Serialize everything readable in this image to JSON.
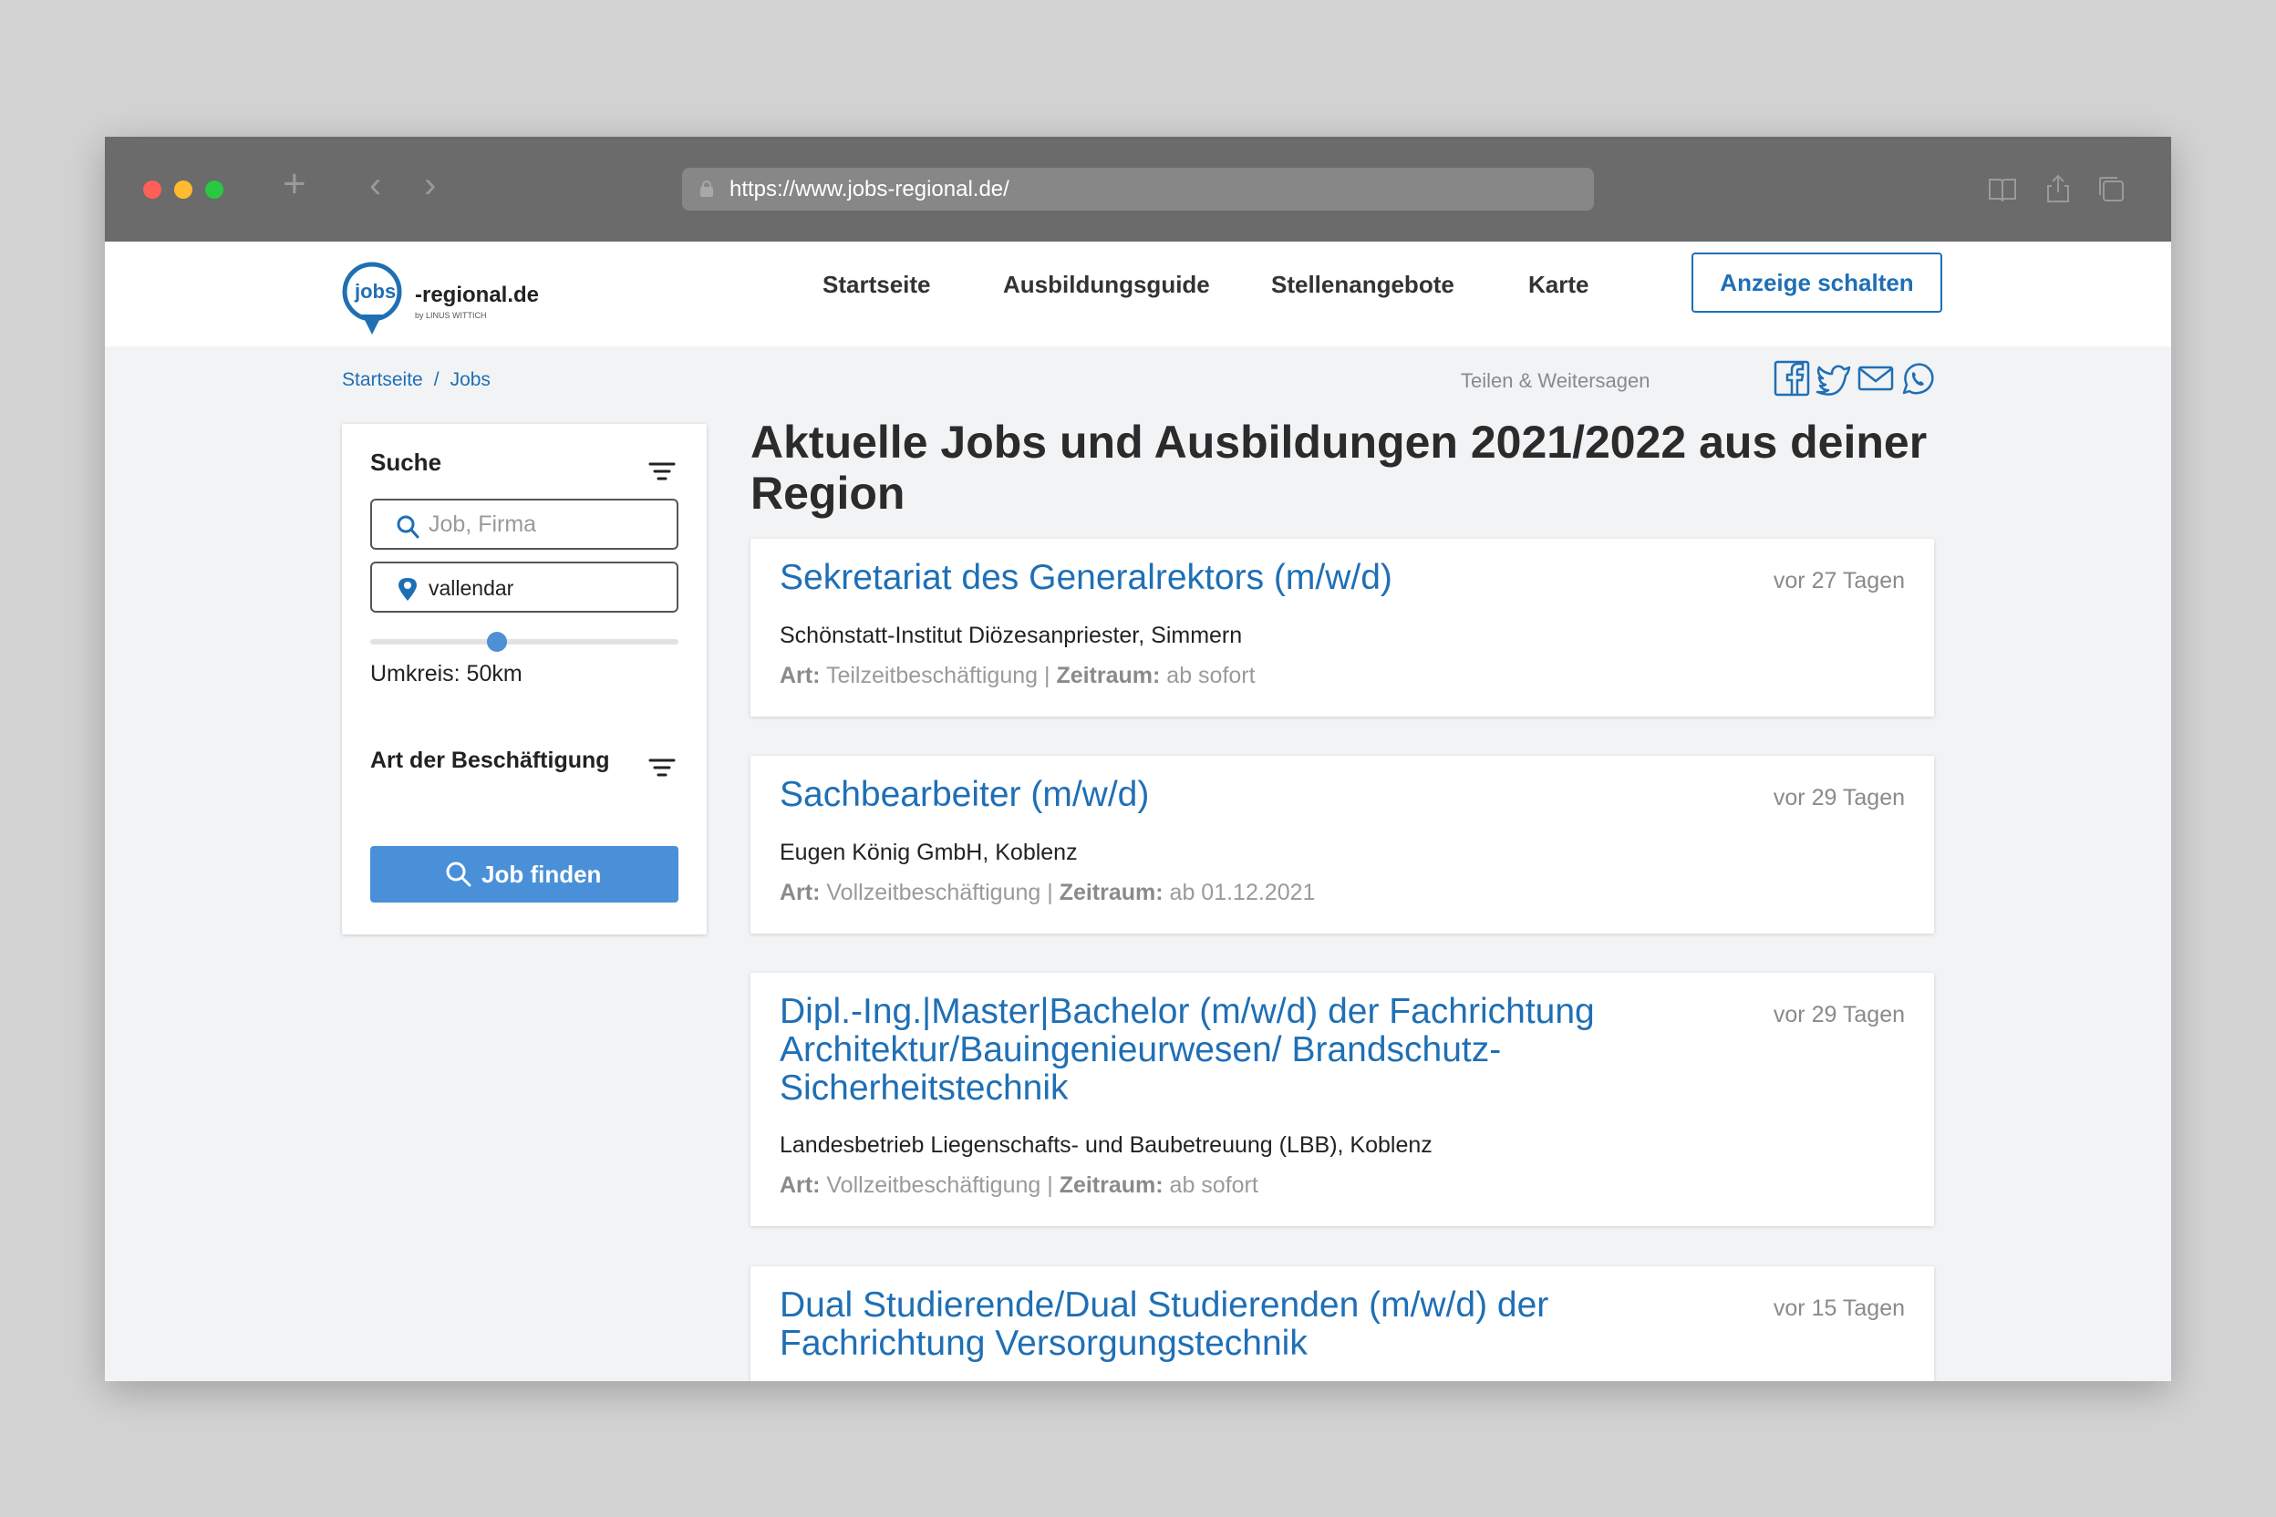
{
  "browser": {
    "url": "https://www.jobs-regional.de/"
  },
  "logo": {
    "pin_text": "jobs",
    "text": "-regional.de",
    "sub": "by LINUS WITTICH"
  },
  "nav": {
    "items": [
      "Startseite",
      "Ausbildungsguide",
      "Stellenangebote",
      "Karte"
    ],
    "cta": "Anzeige schalten"
  },
  "breadcrumb": {
    "items": [
      "Startseite",
      "Jobs"
    ],
    "separator": "/"
  },
  "share": {
    "label": "Teilen & Weitersagen",
    "icons": [
      "facebook-icon",
      "twitter-icon",
      "mail-icon",
      "whatsapp-icon"
    ]
  },
  "sidebar": {
    "search_title": "Suche",
    "search_placeholder": "Job, Firma",
    "location_value": "vallendar",
    "radius_text": "Umkreis: 50km",
    "radius_fraction": 0.41,
    "employment_title": "Art der Beschäftigung",
    "find_button": "Job finden"
  },
  "main": {
    "title": "Aktuelle Jobs und Ausbildungen 2021/2022 aus deiner Region"
  },
  "jobs": [
    {
      "title": "Sekretariat des Generalrektors (m/w/d)",
      "age": "vor 27 Tagen",
      "company": "Schönstatt-Institut Diözesanpriester, Simmern",
      "art_label": "Art:",
      "art": "Teilzeitbeschäftigung",
      "sep": "|",
      "zeitraum_label": "Zeitraum:",
      "zeitraum": "ab sofort"
    },
    {
      "title": "Sachbearbeiter (m/w/d)",
      "age": "vor 29 Tagen",
      "company": "Eugen König GmbH, Koblenz",
      "art_label": "Art:",
      "art": "Vollzeitbeschäftigung",
      "sep": "|",
      "zeitraum_label": "Zeitraum:",
      "zeitraum": "ab 01.12.2021"
    },
    {
      "title": "Dipl.-Ing.|Master|Bachelor (m/w/d) der Fachrichtung Architektur/Bauingenieurwesen/ Brandschutz-Sicherheitstechnik",
      "age": "vor 29 Tagen",
      "company": "Landesbetrieb Liegenschafts- und Baubetreuung (LBB), Koblenz",
      "art_label": "Art:",
      "art": "Vollzeitbeschäftigung",
      "sep": "|",
      "zeitraum_label": "Zeitraum:",
      "zeitraum": "ab sofort"
    },
    {
      "title": "Dual Studierende/Dual Studierenden (m/w/d) der Fachrichtung Versorgungstechnik",
      "age": "vor 15 Tagen"
    }
  ],
  "colors": {
    "brand_blue": "#1f6fb5",
    "button_blue": "#4a90d9",
    "titlebar": "#6b6b6b",
    "page_bg": "#f2f3f5"
  }
}
